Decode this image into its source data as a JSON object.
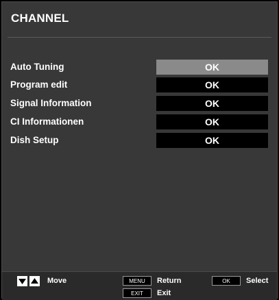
{
  "header": {
    "title": "CHANNEL"
  },
  "menu": {
    "items": [
      {
        "label": "Auto Tuning",
        "button": "OK"
      },
      {
        "label": "Program edit",
        "button": "OK"
      },
      {
        "label": "Signal Information",
        "button": "OK"
      },
      {
        "label": "CI Informationen",
        "button": "OK"
      },
      {
        "label": "Dish Setup",
        "button": "OK"
      }
    ],
    "selected_index": 0
  },
  "footer": {
    "move_label": "Move",
    "menu_key": "MENU",
    "return_label": "Return",
    "exit_key": "EXIT",
    "exit_label": "Exit",
    "ok_key": "OK",
    "select_label": "Select"
  },
  "colors": {
    "panel": "#383838",
    "selected": "#8a8a8a",
    "button": "#000000",
    "text": "#ffffff"
  },
  "icons": {
    "down": "down-arrow-icon",
    "up": "up-arrow-icon"
  }
}
